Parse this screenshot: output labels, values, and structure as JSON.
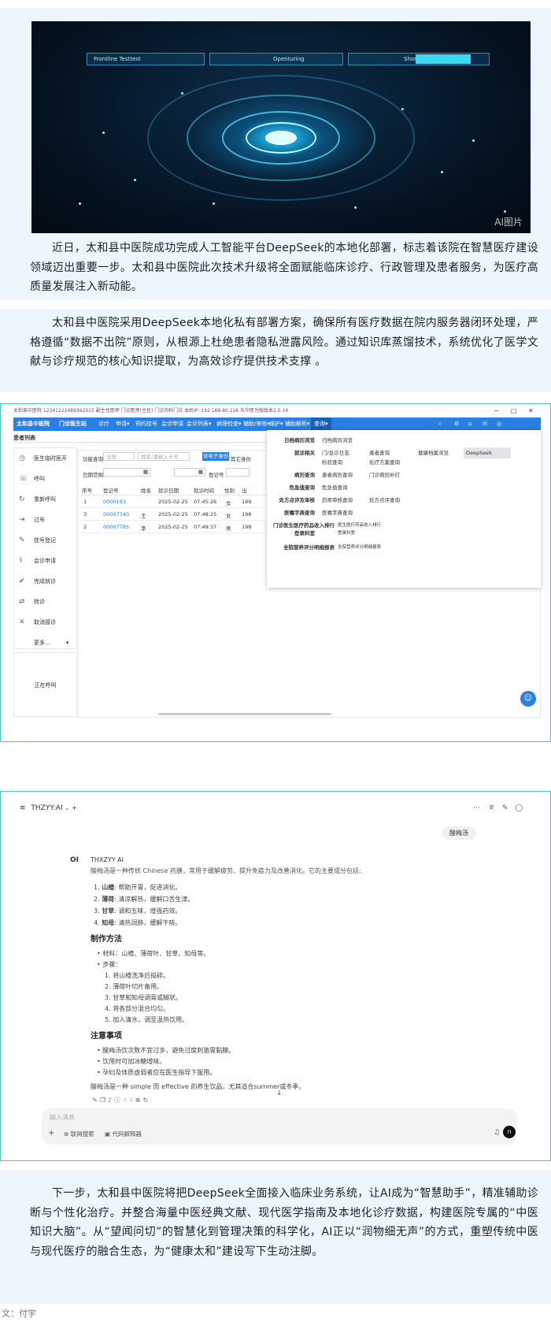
{
  "hero": {
    "label": "AI图片",
    "bars": [
      "Frontline Testtest",
      "Openturing",
      "Shortener"
    ]
  },
  "para1": "近日，太和县中医院成功完成人工智能平台DeepSeek的本地化部署，标志着该院在智慧医疗建设领域迈出重要一步。太和县中医院此次技术升级将全面赋能临床诊疗、行政管理及患者服务，为医疗高质量发展注入新动能。",
  "para2": "太和县中医院采用DeepSeek本地化私有部署方案，确保所有医疗数据在院内服务器闭环处理，严格遵循“数据不出院”原则，从根源上杜绝患者隐私泄露风险。通过知识库蒸馏技术，系统优化了医学文献与诊疗规范的核心知识提取，为高效诊疗提供技术支撑 。",
  "his": {
    "titlebar": "太和县中医院 12341222489362015 副主任医师         门诊医师(主任) 门诊内科门诊 本机IP: 192.168.80.126 东华医为版版本2.0.14",
    "hospital": "太和县中医院",
    "sys": "门诊医生站",
    "menu": [
      "诊疗",
      "申请▾",
      "预约挂号",
      "会诊申请",
      "会诊列表▾",
      "病理检查▾",
      "辅助/审核▾",
      "维护▾",
      "辅助解析▾",
      "查询▾"
    ],
    "section": "患者列表",
    "side": [
      "医生临时医开",
      "呼叫",
      "重新呼叫",
      "过号",
      "挂号登记",
      "会诊申请",
      "完成就诊",
      "转诊",
      "取消接诊",
      "更多..."
    ],
    "sideBottom": "正在呼叫",
    "filters": [
      "功能查询",
      "全部",
      "姓名/请输入卡号",
      "读电子身份",
      "其它身份",
      "日期范围",
      "登记号"
    ],
    "headers": [
      "序号",
      "登记号",
      "姓名",
      "就诊日期",
      "就诊时间",
      "性别",
      "出"
    ],
    "rows": [
      [
        "1",
        "0000193",
        "",
        "2025-02-25",
        "07:45:26",
        "女",
        "199"
      ],
      [
        "3",
        "00007740",
        "王",
        "2025-02-25",
        "07:48:25",
        "女",
        "198"
      ],
      [
        "2",
        "00007785",
        "李",
        "2025-02-25",
        "07:49:37",
        "男",
        "198"
      ]
    ],
    "dropdown": [
      {
        "k": "日档病历浏览",
        "items": [
          "归档病历浏览"
        ]
      },
      {
        "k": "就诊相关",
        "items": [
          "门/急诊日志",
          "患者查询",
          "健康档案浏览",
          "DeepSeek"
        ]
      },
      {
        "k": "",
        "items": [
          "检验查询",
          "化疗方案查询"
        ]
      },
      {
        "k": "病历查询",
        "items": [
          "患者病历查询",
          "门诊病历补打"
        ]
      },
      {
        "k": "危急值查询",
        "items": [
          "危急值查询"
        ]
      },
      {
        "k": "处方点评及审核",
        "items": [
          "药师审核查询",
          "处方点评查询"
        ]
      },
      {
        "k": "医嘱字典查询",
        "items": [
          "医嘱字典查询"
        ]
      },
      {
        "k": "门诊医生医疗药品收入排行",
        "items": [
          "医生医疗药品收入排行"
        ]
      },
      {
        "k": "登录科室",
        "items": [
          "登录科室"
        ]
      },
      {
        "k": "全院营养评分明细报表",
        "items": [
          "全院营养评分明细报表"
        ]
      }
    ]
  },
  "chat": {
    "model": "THZYY:AI",
    "userMsg": "酸梅汤",
    "botName": "THXZYY AI",
    "intro": "酸梅汤是一种传统 Chinese 药膳，常用于缓解疲劳、提升免疫力及改善消化。它的主要成分包括:",
    "ingredients": [
      [
        "山楂",
        "帮助开胃，促进消化。"
      ],
      [
        "薄荷",
        "清凉解热，缓解口舌生津。"
      ],
      [
        "甘草",
        "调和五味，增强药效。"
      ],
      [
        "知母",
        "清热润肺，缓解干咳。"
      ]
    ],
    "h1": "制作方法",
    "materials": "材料：山楂、薄荷叶、甘草、知母等。",
    "steps": "步骤：",
    "stepList": [
      "将山楂洗净后捣碎。",
      "薄荷叶切片备用。",
      "甘草和知母调膏或糊状。",
      "将各部分混合均匀。",
      "加入清水，调至温热饮用。"
    ],
    "h2": "注意事项",
    "notes": [
      "酸梅汤饮次数不宜过多，避免过度刺激胃黏膜。",
      "饮用时可加冰糖增味。",
      "孕妇及体质虚弱者应在医生指导下服用。"
    ],
    "summary": "酸梅汤是一种 simple 而 effective 的养生饮品，尤其适合summer或冬季。",
    "inputPh": "输入消息",
    "btn1": "联网搜索",
    "btn2": "代码解释器"
  },
  "para3": "下一步，太和县中医院将把DeepSeek全面接入临床业务系统，让AI成为“智慧助手”，精准辅助诊断与个性化治疗。并整合海量中医经典文献、现代医学指南及本地化诊疗数据，构建医院专属的“中医知识大脑”。从“望闻问切”的智慧化到管理决策的科学化，AI正以“润物细无声”的方式，重塑传统中医与现代医疗的融合生态，为“健康太和”建设写下生动注脚。",
  "byline": "文：付宇"
}
